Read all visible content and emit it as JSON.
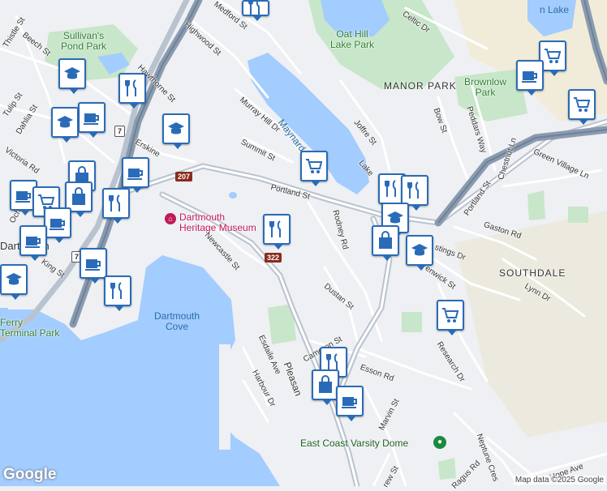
{
  "map": {
    "attribution": "Map data ©2025 Google",
    "logo": "Google",
    "water_color": "#a3ccff",
    "park_color": "#c8e6c9",
    "marker_color": "#2a6bb8"
  },
  "places": {
    "manor_park": "MANOR PARK",
    "southdale": "SOUTHDALE",
    "dartmouth": "Dartmouth",
    "dartmouth_cove": "Dartmouth\nCove",
    "maynard_lake": "Maynard Lake",
    "sullivans_pond_park": "Sullivan's\nPond Park",
    "oat_hill_lake_park": "Oat Hill\nLake Park",
    "brownlow_park": "Brownlow\nPark",
    "ferry_terminal_park": "Ferry\nTerminal Park",
    "dartmouth_heritage_museum": "Dartmouth\nHeritage Museum",
    "east_coast_varsity_dome": "East Coast Varsity Dome",
    "lake_fragment": "n Lake"
  },
  "streets": {
    "portland_st": "Portland St",
    "portland_st_2": "Portland St",
    "hawthorne_st": "Hawthorne St",
    "highwood_st": "Highwood St",
    "medford_st": "Medford St",
    "murray_hill_dr": "Murray Hill Dr",
    "summit_st": "Summit St",
    "erskine_st": "Erskine",
    "thistle_st": "Thistle St",
    "beech_st": "Beech St",
    "tulip_st": "Tulip St",
    "dahlia_st": "Dahlia St",
    "victoria_rd": "Victoria Rd",
    "ochterloney": "Ochte",
    "king_st": "King St",
    "newcastle_st": "Newcastle St",
    "rodney_rd": "Rodney Rd",
    "dustan_st": "Dustan St",
    "joffre_st": "Joffre St",
    "lakeview": "Lake",
    "celtic_dr": "Celtic Dr",
    "bow_st": "Bow St",
    "peddars_way": "Peddars Way",
    "chestnut_ln": "Chestnut Ln",
    "green_village_ln": "Green Village Ln",
    "gaston_rd": "Gaston Rd",
    "hastings_dr": "stings Dr",
    "fenwick_st": "enwick St",
    "lynn_dr": "Lynn Dr",
    "research_dr": "Research Dr",
    "esson_rd": "Esson Rd",
    "cameron_st": "Cameron St",
    "pleasant_st": "Pleasan",
    "esdaile_ave": "Esdaile Ave",
    "harbour_dr": "Harbour Dr",
    "marvin_st": "Marvin St",
    "neptune_cres": "Neptune Cres",
    "ragus_rd": "Ragus Rd",
    "hope_ave": "Hope Ave",
    "andrew_st": "rew St"
  },
  "shields": {
    "r207": "207",
    "r322": "322",
    "r7": "7",
    "r7b": "7"
  }
}
